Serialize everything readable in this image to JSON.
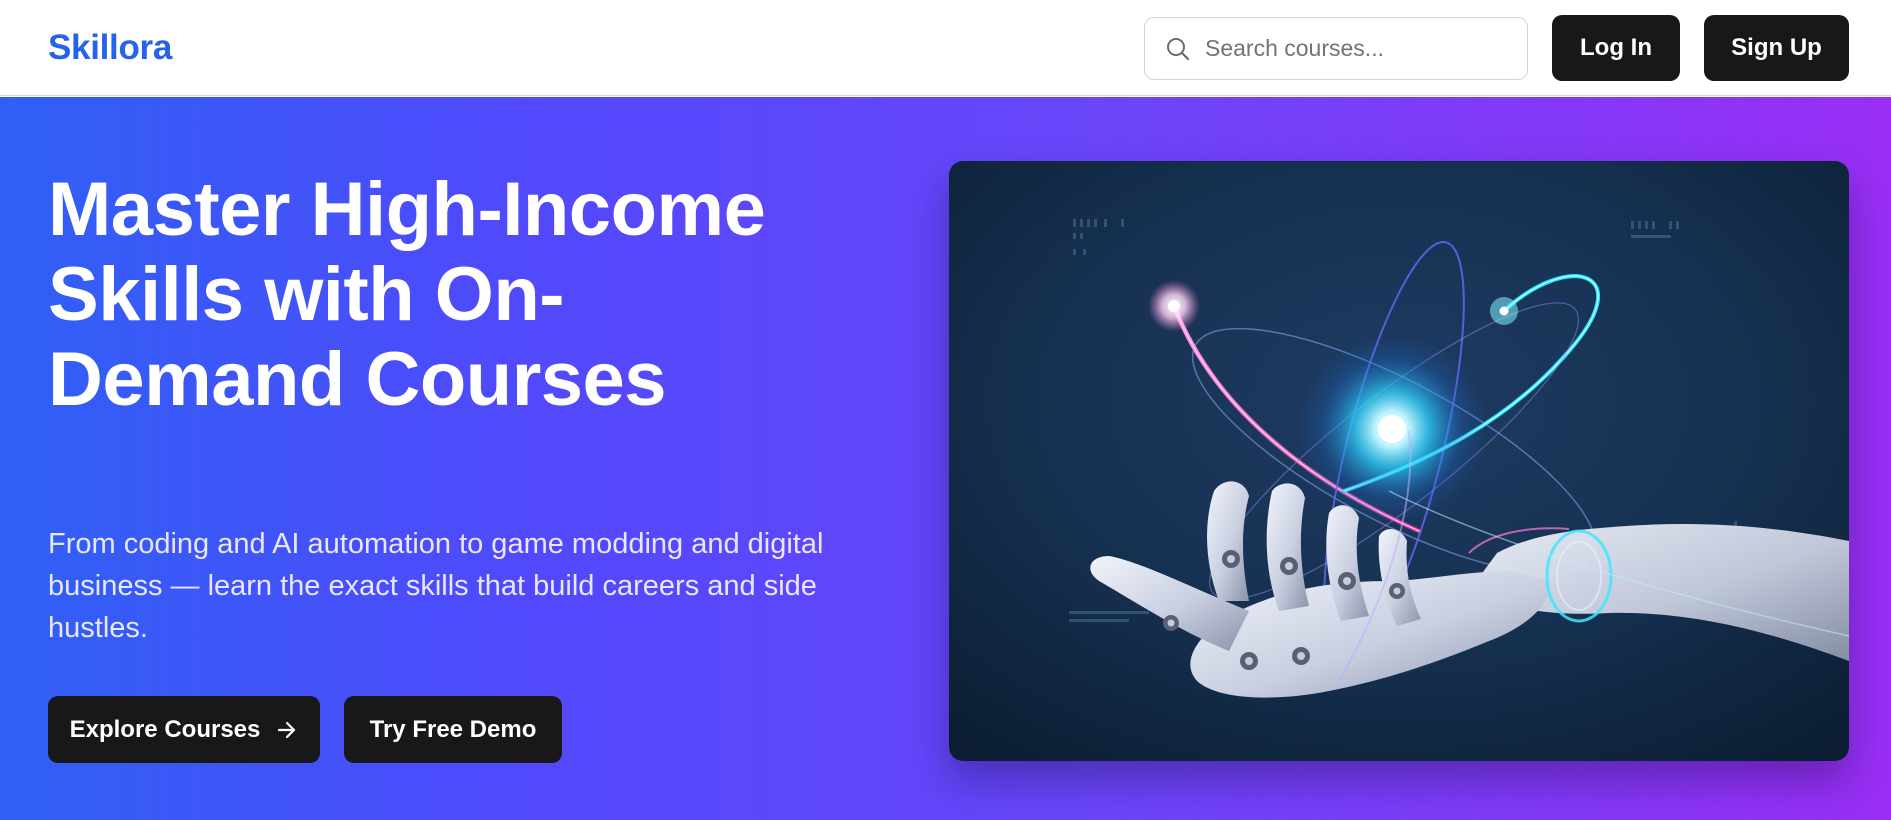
{
  "brand": {
    "name": "Skillora",
    "color": "#2563eb"
  },
  "nav": {
    "search_placeholder": "Search courses...",
    "search_icon": "search-icon",
    "login_label": "Log In",
    "signup_label": "Sign Up"
  },
  "hero": {
    "headline": "Master High-Income Skills with On-Demand Courses",
    "subtext": "From coding and AI automation to game modding and digital business — learn the exact skills that build careers and side hustles.",
    "explore_label": "Explore Courses",
    "explore_icon": "arrow-right-icon",
    "demo_label": "Try Free Demo",
    "image_subject": "robotic hand holding glowing atom",
    "gradient": [
      "#2f60f5",
      "#5149fb",
      "#6a45fa",
      "#8637f7",
      "#9a2ef5"
    ]
  },
  "colors": {
    "button_dark": "#18181b",
    "button_text": "#ffffff"
  }
}
